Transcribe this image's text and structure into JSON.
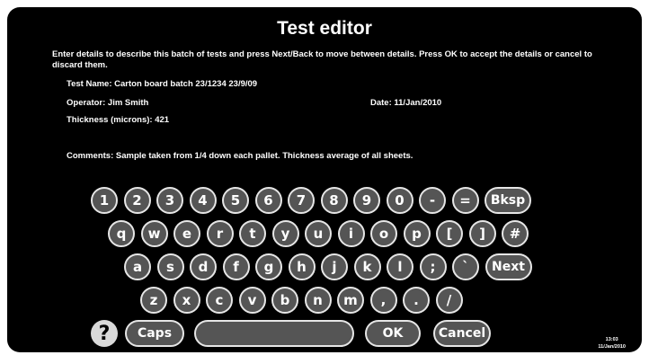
{
  "title": "Test editor",
  "instructions": "Enter details to describe this batch of tests and press Next/Back to move between details. Press OK to accept the details or cancel to discard them.",
  "fields": {
    "test_name": "Test Name: Carton board batch 23/1234 23/9/09",
    "operator": "Operator: Jim Smith",
    "date": "Date: 11/Jan/2010",
    "thickness": "Thickness (microns): 421",
    "comments": "Comments: Sample taken from 1/4 down each pallet. Thickness average of all sheets."
  },
  "keyboard": {
    "row1": [
      "1",
      "2",
      "3",
      "4",
      "5",
      "6",
      "7",
      "8",
      "9",
      "0",
      "-",
      "=",
      "Bksp"
    ],
    "row2": [
      "q",
      "w",
      "e",
      "r",
      "t",
      "y",
      "u",
      "i",
      "o",
      "p",
      "[",
      "]",
      "#"
    ],
    "row3": [
      "a",
      "s",
      "d",
      "f",
      "g",
      "h",
      "j",
      "k",
      "l",
      ";",
      "`",
      "Next"
    ],
    "row4": [
      "z",
      "x",
      "c",
      "v",
      "b",
      "n",
      "m",
      ",",
      ".",
      "/"
    ],
    "caps": "Caps",
    "space": "",
    "ok": "OK",
    "cancel": "Cancel",
    "help": "?"
  },
  "clock": {
    "time": "13:03",
    "date": "11/Jan/2010"
  }
}
